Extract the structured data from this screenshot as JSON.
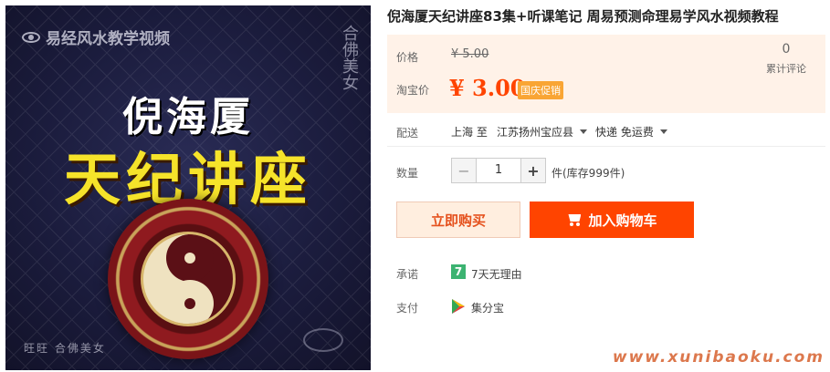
{
  "image": {
    "caption": "易经风水教学视频",
    "seal": "合佛美女",
    "name": "倪海厦",
    "title": "天纪讲座",
    "footer": "旺旺 合佛美女"
  },
  "product": {
    "title": "倪海厦天纪讲座83集+听课笔记 周易预测命理易学风水视频教程"
  },
  "price": {
    "orig_label": "价格",
    "orig_price": "¥ 5.00",
    "promo_label": "淘宝价",
    "promo_price": "¥ 3.00",
    "promo_badge": "国庆促销",
    "review_count": "0",
    "review_label": "累计评论"
  },
  "shipping": {
    "label": "配送",
    "from": "上海 至",
    "to": "江苏扬州宝应县",
    "method": "快递 免运费"
  },
  "quantity": {
    "label": "数量",
    "minus": "−",
    "value": "1",
    "plus": "+",
    "unit": "件(库存999件)"
  },
  "buttons": {
    "buy_now": "立即购买",
    "add_cart": "加入购物车"
  },
  "promise": {
    "label": "承诺",
    "icon": "7",
    "text": "7天无理由"
  },
  "payment": {
    "label": "支付",
    "text": "集分宝"
  },
  "watermark": "www.xunibaoku.com",
  "colors": {
    "accent": "#ff4400",
    "price_panel": "#fff2e8",
    "badge": "#f9a534"
  }
}
